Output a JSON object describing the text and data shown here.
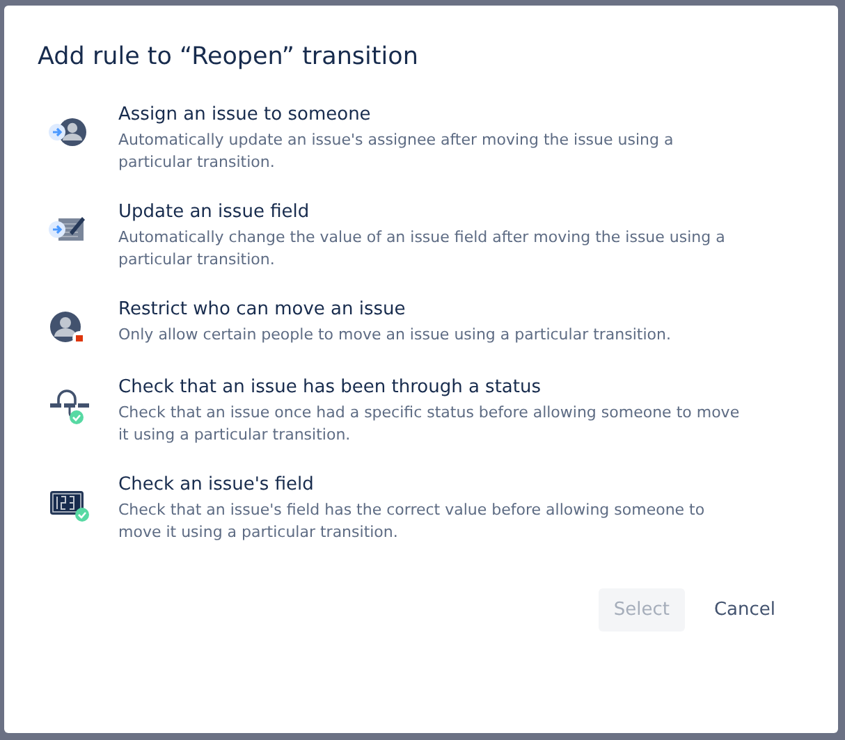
{
  "dialog": {
    "title": "Add rule to “Reopen” transition",
    "rules": [
      {
        "kind": "assign",
        "title": "Assign an issue to someone",
        "description": "Automatically update an issue's assignee after moving the issue using a particular transition."
      },
      {
        "kind": "update-field",
        "title": "Update an issue field",
        "description": "Automatically change the value of an issue field after moving the issue using a particular transition."
      },
      {
        "kind": "restrict",
        "title": "Restrict who can move an issue",
        "description": "Only allow certain people to move an issue using a particular transition."
      },
      {
        "kind": "status-check",
        "title": "Check that an issue has been through a status",
        "description": "Check that an issue once had a specific status before allowing someone to move it using a particular transition."
      },
      {
        "kind": "field-check",
        "title": "Check an issue's field",
        "description": "Check that an issue's field has the correct value before allowing someone to move it using a particular transition."
      }
    ],
    "buttons": [
      {
        "kind": "primary",
        "label": "Select",
        "disabled": true
      },
      {
        "kind": "subtle",
        "label": "Cancel",
        "disabled": false
      }
    ]
  }
}
